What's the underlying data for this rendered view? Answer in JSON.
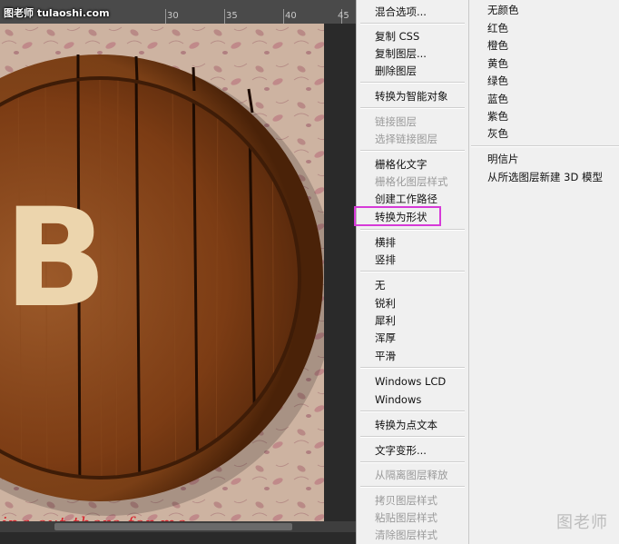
{
  "watermark_top": "图老师 tulaoshi.com",
  "ruler": {
    "labels": [
      "30",
      "35",
      "40",
      "45"
    ]
  },
  "canvas": {
    "letter": "B",
    "caption": "ing out there for me",
    "colors": {
      "wood_dark": "#3a1a08",
      "wood": "#7a3a14",
      "letter": "#ecd5ad",
      "caption": "#d8202a"
    }
  },
  "menu": {
    "items": [
      {
        "label": "混合选项...",
        "disabled": false
      },
      {
        "label": "复制 CSS",
        "disabled": false
      },
      {
        "label": "复制图层...",
        "disabled": false
      },
      {
        "label": "删除图层",
        "disabled": false
      },
      {
        "label": "转换为智能对象",
        "disabled": false
      },
      {
        "label": "链接图层",
        "disabled": true
      },
      {
        "label": "选择链接图层",
        "disabled": true
      },
      {
        "label": "栅格化文字",
        "disabled": false
      },
      {
        "label": "栅格化图层样式",
        "disabled": true
      },
      {
        "label": "创建工作路径",
        "disabled": false
      },
      {
        "label": "转换为形状",
        "disabled": false
      },
      {
        "label": "横排",
        "disabled": false
      },
      {
        "label": "竖排",
        "disabled": false
      },
      {
        "label": "无",
        "disabled": false
      },
      {
        "label": "锐利",
        "disabled": false
      },
      {
        "label": "犀利",
        "disabled": false
      },
      {
        "label": "浑厚",
        "disabled": false
      },
      {
        "label": "平滑",
        "disabled": false
      },
      {
        "label": "Windows LCD",
        "disabled": false
      },
      {
        "label": "Windows",
        "disabled": false
      },
      {
        "label": "转换为点文本",
        "disabled": false
      },
      {
        "label": "文字变形...",
        "disabled": false
      },
      {
        "label": "从隔离图层释放",
        "disabled": true
      },
      {
        "label": "拷贝图层样式",
        "disabled": true
      },
      {
        "label": "粘贴图层样式",
        "disabled": true
      },
      {
        "label": "清除图层样式",
        "disabled": true
      }
    ],
    "highlight_color": "#d63ad8"
  },
  "submenu": {
    "items": [
      {
        "label": "无颜色"
      },
      {
        "label": "红色"
      },
      {
        "label": "橙色"
      },
      {
        "label": "黄色"
      },
      {
        "label": "绿色"
      },
      {
        "label": "蓝色"
      },
      {
        "label": "紫色"
      },
      {
        "label": "灰色"
      },
      {
        "label": "明信片"
      },
      {
        "label": "从所选图层新建 3D 模型"
      }
    ]
  },
  "watermark_bottom": "图老师"
}
